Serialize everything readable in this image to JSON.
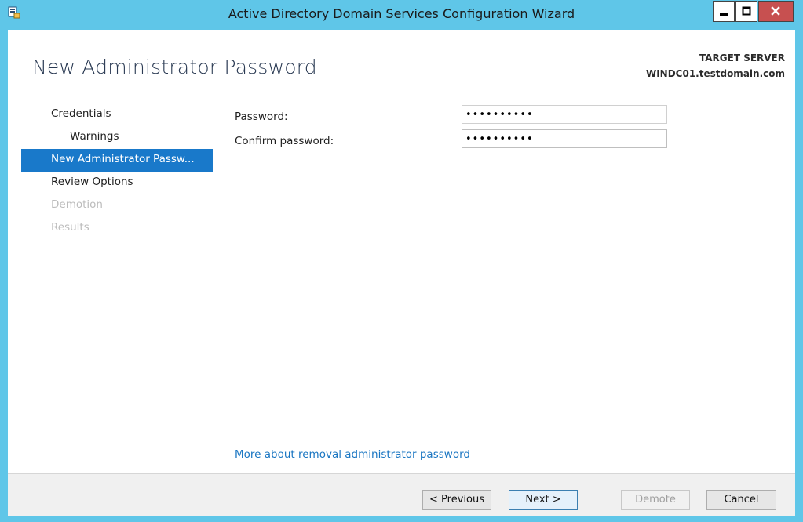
{
  "window": {
    "title": "Active Directory Domain Services Configuration Wizard",
    "icon": "server-manager-icon",
    "controls": [
      "minimize-icon",
      "maximize-icon",
      "close-icon"
    ]
  },
  "header": {
    "page_title": "New Administrator Password",
    "target_label": "TARGET SERVER",
    "target_server": "WINDC01.testdomain.com"
  },
  "nav": {
    "items": [
      {
        "label": "Credentials",
        "state": "normal"
      },
      {
        "label": "Warnings",
        "state": "sub"
      },
      {
        "label": "New Administrator Passw...",
        "state": "active"
      },
      {
        "label": "Review Options",
        "state": "normal"
      },
      {
        "label": "Demotion",
        "state": "disabled"
      },
      {
        "label": "Results",
        "state": "disabled"
      }
    ]
  },
  "form": {
    "password_label": "Password:",
    "password_value": "••••••••••",
    "confirm_label": "Confirm password:",
    "confirm_value": "••••••••••"
  },
  "help_link": "More about removal administrator password",
  "buttons": {
    "previous": "< Previous",
    "next": "Next >",
    "demote": "Demote",
    "cancel": "Cancel"
  },
  "colors": {
    "titlebar": "#5fc6e8",
    "accent": "#1979ca",
    "link": "#1a76c2",
    "close": "#c75050"
  }
}
